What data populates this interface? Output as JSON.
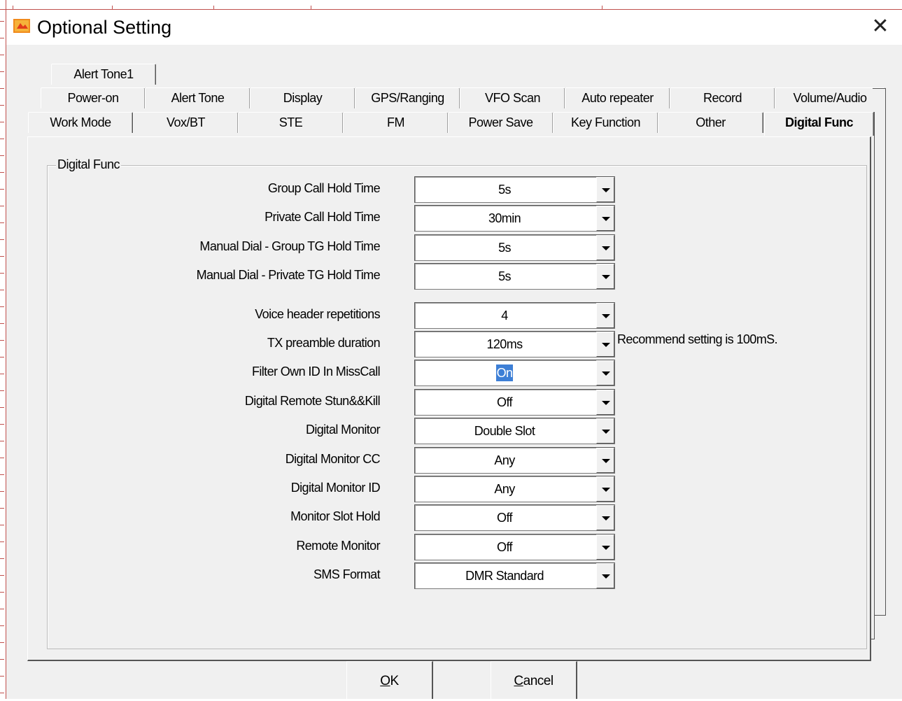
{
  "window": {
    "title": "Optional Setting",
    "close_symbol": "✕"
  },
  "tabs": {
    "row3": [
      "Alert Tone1"
    ],
    "row2": [
      "Power-on",
      "Alert Tone",
      "Display",
      "GPS/Ranging",
      "VFO Scan",
      "Auto repeater",
      "Record",
      "Volume/Audio"
    ],
    "row1": [
      "Work Mode",
      "Vox/BT",
      "STE",
      "FM",
      "Power Save",
      "Key Function",
      "Other",
      "Digital Func"
    ],
    "active": "Digital Func"
  },
  "group": {
    "title": "Digital Func"
  },
  "settings": [
    {
      "label": "Group Call Hold Time",
      "value": "5s"
    },
    {
      "label": "Private Call Hold Time",
      "value": "30min"
    },
    {
      "label": "Manual Dial - Group TG Hold Time",
      "value": "5s"
    },
    {
      "label": "Manual Dial - Private TG Hold Time",
      "value": "5s"
    },
    {
      "label": "Voice header repetitions",
      "value": "4"
    },
    {
      "label": "TX preamble duration",
      "value": "120ms"
    },
    {
      "label": "Filter Own ID In MissCall",
      "value": "On"
    },
    {
      "label": "Digital Remote Stun&&Kill",
      "value": "Off"
    },
    {
      "label": "Digital Monitor",
      "value": "Double Slot"
    },
    {
      "label": "Digital Monitor CC",
      "value": "Any"
    },
    {
      "label": "Digital Monitor ID",
      "value": "Any"
    },
    {
      "label": "Monitor Slot Hold",
      "value": "Off"
    },
    {
      "label": "Remote Monitor",
      "value": "Off"
    },
    {
      "label": "SMS Format",
      "value": "DMR Standard"
    }
  ],
  "notes": {
    "tx_preamble": "Recommend setting is 100mS."
  },
  "buttons": {
    "ok_mnemonic": "O",
    "ok_rest": "K",
    "cancel_mnemonic": "C",
    "cancel_rest": "ancel"
  },
  "colors": {
    "selection": "#3d7fd6",
    "background_window_border": "#c0504d"
  }
}
